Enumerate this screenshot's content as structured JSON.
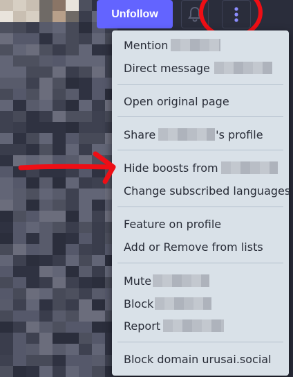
{
  "header": {
    "unfollow_label": "Unfollow",
    "bell_icon": "bell-icon",
    "more_icon": "ellipsis-vertical-icon"
  },
  "menu": {
    "items": [
      {
        "label": "Mention",
        "suffix": ""
      },
      {
        "label": "Direct message",
        "suffix": ""
      },
      {
        "label": "Open original page",
        "suffix": ""
      },
      {
        "label": "Share",
        "suffix": "'s profile"
      },
      {
        "label": "Hide boosts from",
        "suffix": ""
      },
      {
        "label": "Change subscribed languages",
        "suffix": ""
      },
      {
        "label": "Feature on profile",
        "suffix": ""
      },
      {
        "label": "Add or Remove from lists",
        "suffix": ""
      },
      {
        "label": "Mute",
        "suffix": ""
      },
      {
        "label": "Block",
        "suffix": ""
      },
      {
        "label": "Report",
        "suffix": ""
      },
      {
        "label": "Block domain urusai.social",
        "suffix": ""
      }
    ]
  },
  "colors": {
    "accent": "#6364ff",
    "menu_bg": "#d9e1e8",
    "page_bg": "#2a2d3b",
    "annotation": "#ee0e15"
  }
}
